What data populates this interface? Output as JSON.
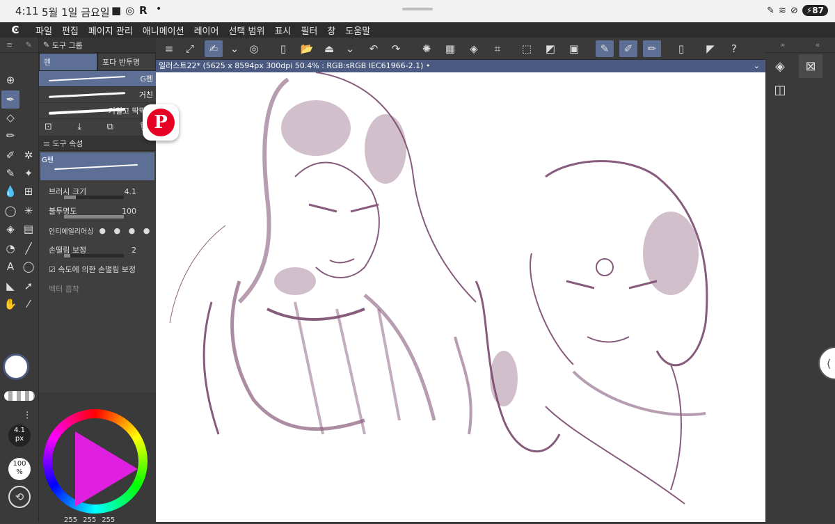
{
  "status": {
    "time": "4:11",
    "date": "5월 1일 금요일",
    "battery": "87"
  },
  "menu": {
    "logo": "Ͼ",
    "items": [
      "파일",
      "편집",
      "페이지 관리",
      "애니메이션",
      "레이어",
      "선택 범위",
      "표시",
      "필터",
      "창",
      "도움말"
    ]
  },
  "toolgroup": {
    "header": "도구 그룹",
    "tab1": "펜",
    "tab2": "포다 반투명",
    "brushes": [
      "G펜",
      "거친",
      "거칠고 딱딱한"
    ]
  },
  "props": {
    "header": "도구 속성",
    "preview": "G펜",
    "brushsize_label": "브러시 크기",
    "brushsize": "4.1",
    "opacity_label": "불투명도",
    "opacity": "100",
    "aa_label": "안티에일리어싱",
    "stab_label": "손떨림 보정",
    "stab": "2",
    "speed_label": "속도에 의한 손떨림 보정",
    "vector_label": "벡터 흡착"
  },
  "document": {
    "title": "일러스트22* (5625 x 8594px 300dpi 50.4% : RGB:sRGB IEC61966-2.1)"
  },
  "color": {
    "r": "255",
    "g": "255",
    "b": "255"
  },
  "left": {
    "size": "4.1",
    "unit": "px",
    "op": "100",
    "op_unit": "%"
  },
  "colors": {
    "accent": "#5d6f95",
    "sketch": "#7a4a6e"
  }
}
